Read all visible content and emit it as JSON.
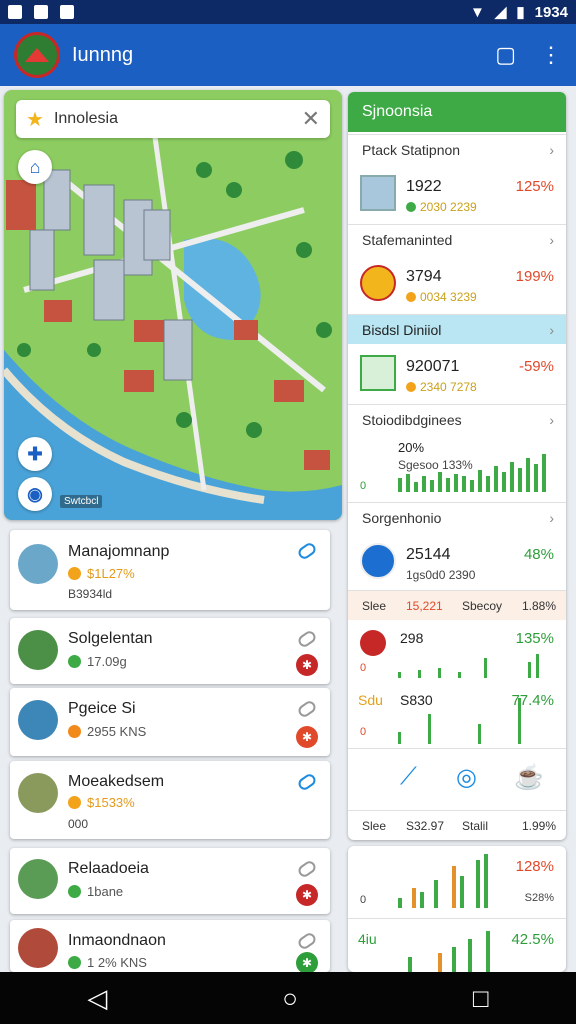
{
  "status": {
    "time": "1934"
  },
  "app": {
    "title": "Iunnng"
  },
  "map": {
    "search_value": "Innolesia",
    "credit": "Swtcbcl"
  },
  "places": [
    {
      "name": "Manajomnanp",
      "rating": "$1L27%",
      "sub": "B3934ld",
      "dot": "#f2a31b"
    },
    {
      "name": "Solgelentan",
      "rating": "17.09g",
      "sub": "",
      "dot": "#3daa45",
      "pin": "#c62828"
    },
    {
      "name": "Pgeice Si",
      "rating": "2955 KNS",
      "sub": "",
      "dot": "#f28a1b",
      "pin": "#e04a2a"
    },
    {
      "name": "Moeakedsem",
      "rating": "$1533%",
      "sub": "000",
      "dot": "#f2a31b"
    },
    {
      "name": "Relaadoeia",
      "rating": "1bane",
      "sub": "",
      "dot": "#3daa45",
      "pin": "#c62828"
    },
    {
      "name": "Inmaondnaon",
      "rating": "1 2% KNS",
      "sub": "",
      "dot": "#3daa45",
      "pin": "#2e9e3a"
    }
  ],
  "panel": {
    "title": "Sjnoonsia",
    "sections": [
      {
        "label": "Ptack Statipnon",
        "value": "1922",
        "pct": "125%",
        "small": "2030 2239"
      },
      {
        "label": "Stafemaninted",
        "value": "3794",
        "pct": "199%",
        "small": "0034 3239"
      },
      {
        "label": "Bisdsl Diniiol",
        "value": "920071",
        "pct": "-59%",
        "small": "2340 7278"
      },
      {
        "label": "Stoiodibdginees",
        "value": "20%",
        "small": "Sgesoo 133%"
      },
      {
        "label": "Sorgenhonio",
        "value": "25144",
        "pct": "48%",
        "small": "1gs0d0 2390"
      }
    ],
    "legend_row": {
      "a": "Slee",
      "b": "15,221",
      "c": "Sbecoy",
      "d": "1.88%"
    },
    "chart_rows": [
      {
        "value": "298",
        "pct": "135%"
      },
      {
        "label": "Sdu",
        "value": "S830",
        "pct": "77.4%"
      }
    ],
    "legend_row2": {
      "a": "Slee",
      "b": "S32.97",
      "c": "Stalil",
      "d": "1.99%"
    },
    "bottom_rows": [
      {
        "pct": "128%",
        "small": "S28%"
      },
      {
        "label": "4iu",
        "pct": "42.5%"
      }
    ]
  },
  "zero": "0"
}
